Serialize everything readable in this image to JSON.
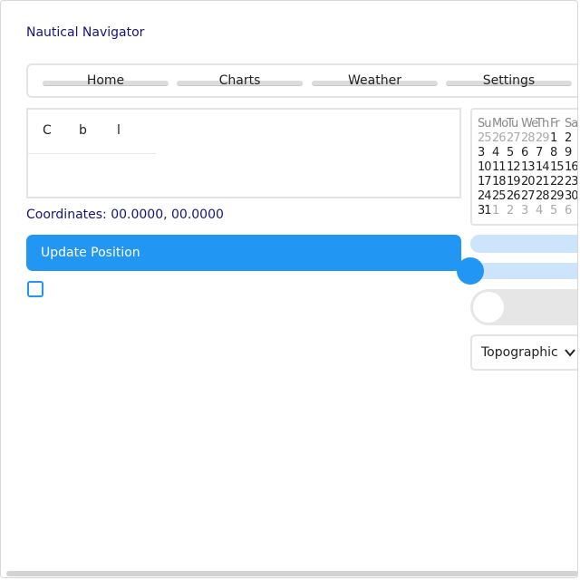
{
  "app": {
    "title": "Nautical Navigator"
  },
  "nav": {
    "items": [
      {
        "label": "Home"
      },
      {
        "label": "Charts"
      },
      {
        "label": "Weather"
      },
      {
        "label": "Settings"
      }
    ]
  },
  "editor": {
    "toolbar": [
      {
        "label": "C"
      },
      {
        "label": "b"
      },
      {
        "label": "l"
      }
    ],
    "content": ""
  },
  "coordinates": {
    "label": "Coordinates:",
    "value": "00.0000, 00.0000"
  },
  "update_button": {
    "label": "Update Position"
  },
  "checkbox": {
    "checked": false
  },
  "calendar": {
    "weekdays": [
      "Su",
      "Mo",
      "Tu",
      "We",
      "Th",
      "Fr",
      "Sa"
    ],
    "rows": [
      [
        "25",
        "26",
        "27",
        "28",
        "29",
        "1",
        "2"
      ],
      [
        "3",
        "4",
        "5",
        "6",
        "7",
        "8",
        "9"
      ],
      [
        "10",
        "11",
        "12",
        "13",
        "14",
        "15",
        "16"
      ],
      [
        "17",
        "18",
        "19",
        "20",
        "21",
        "22",
        "23"
      ],
      [
        "24",
        "25",
        "26",
        "27",
        "28",
        "29",
        "30"
      ],
      [
        "31",
        "1",
        "2",
        "3",
        "4",
        "5",
        "6"
      ]
    ],
    "out_of_month": [
      [
        true,
        true,
        true,
        true,
        true,
        false,
        false
      ],
      [
        false,
        false,
        false,
        false,
        false,
        false,
        false
      ],
      [
        false,
        false,
        false,
        false,
        false,
        false,
        false
      ],
      [
        false,
        false,
        false,
        false,
        false,
        false,
        false
      ],
      [
        false,
        false,
        false,
        false,
        false,
        false,
        false
      ],
      [
        false,
        true,
        true,
        true,
        true,
        true,
        true
      ]
    ]
  },
  "progress": {
    "value_percent": 0
  },
  "slider": {
    "value_percent": 0
  },
  "toggle": {
    "on": false
  },
  "map_style_select": {
    "selected": "Topographic"
  },
  "colors": {
    "accent": "#2196f3",
    "accent_light": "#cde5fb",
    "title_text": "#14147a",
    "border": "#e4e4e4"
  }
}
